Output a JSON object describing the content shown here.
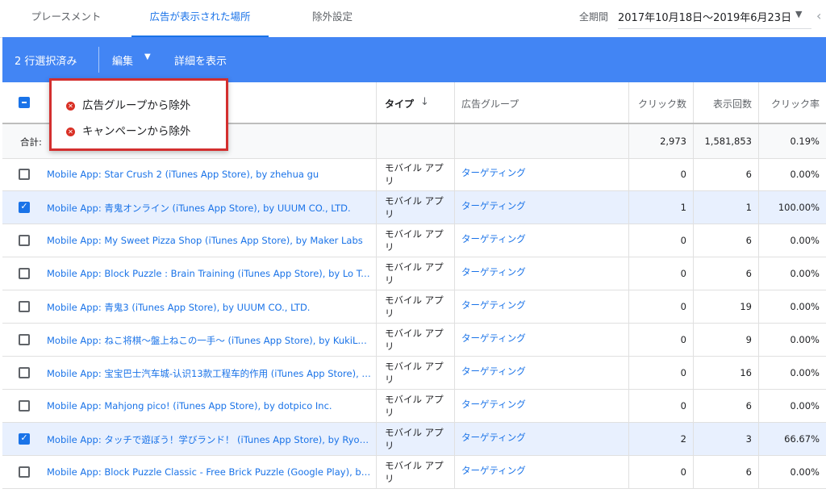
{
  "tabs": [
    "プレースメント",
    "広告が表示された場所",
    "除外設定"
  ],
  "active_tab": 1,
  "date": {
    "label": "全期間",
    "value": "2017年10月18日〜2019年6月23日"
  },
  "selection_bar": {
    "count_label": "2 行選択済み",
    "edit_label": "編集",
    "details_label": "詳細を表示"
  },
  "menu": {
    "items": [
      "広告グループから除外",
      "キャンペーンから除外"
    ]
  },
  "columns": {
    "type": "タイプ",
    "sort_icon": "arrow-down",
    "ad_group": "広告グループ",
    "clicks": "クリック数",
    "impressions": "表示回数",
    "ctr": "クリック率"
  },
  "total": {
    "label": "合計: ",
    "clicks": "2,973",
    "impressions": "1,581,853",
    "ctr": "0.19%"
  },
  "rows": [
    {
      "checked": false,
      "placement": "Mobile App: Star Crush 2 (iTunes App Store), by zhehua gu",
      "type": "モバイル アプリ",
      "ad_group": "ターゲティング",
      "clicks": "0",
      "impressions": "6",
      "ctr": "0.00%"
    },
    {
      "checked": true,
      "placement": "Mobile App: 青鬼オンライン (iTunes App Store), by UUUM CO., LTD.",
      "type": "モバイル アプリ",
      "ad_group": "ターゲティング",
      "clicks": "1",
      "impressions": "1",
      "ctr": "100.00%"
    },
    {
      "checked": false,
      "placement": "Mobile App: My Sweet Pizza Shop (iTunes App Store), by Maker Labs",
      "type": "モバイル アプリ",
      "ad_group": "ターゲティング",
      "clicks": "0",
      "impressions": "6",
      "ctr": "0.00%"
    },
    {
      "checked": false,
      "placement": "Mobile App: Block Puzzle : Brain Training (iTunes App Store), by Lo Trung ...",
      "type": "モバイル アプリ",
      "ad_group": "ターゲティング",
      "clicks": "0",
      "impressions": "6",
      "ctr": "0.00%"
    },
    {
      "checked": false,
      "placement": "Mobile App: 青鬼3 (iTunes App Store), by UUUM CO., LTD.",
      "type": "モバイル アプリ",
      "ad_group": "ターゲティング",
      "clicks": "0",
      "impressions": "19",
      "ctr": "0.00%"
    },
    {
      "checked": false,
      "placement": "Mobile App: ねこ将棋〜盤上ねこの一手〜 (iTunes App Store), by KukiLabo",
      "type": "モバイル アプリ",
      "ad_group": "ターゲティング",
      "clicks": "0",
      "impressions": "9",
      "ctr": "0.00%"
    },
    {
      "checked": false,
      "placement": "Mobile App: 宝宝巴士汽车城-认识13款工程车的作用 (iTunes App Store), b...",
      "type": "モバイル アプリ",
      "ad_group": "ターゲティング",
      "clicks": "0",
      "impressions": "16",
      "ctr": "0.00%"
    },
    {
      "checked": false,
      "placement": "Mobile App: Mahjong pico! (iTunes App Store), by dotpico Inc.",
      "type": "モバイル アプリ",
      "ad_group": "ターゲティング",
      "clicks": "0",
      "impressions": "6",
      "ctr": "0.00%"
    },
    {
      "checked": true,
      "placement": "Mobile App: タッチで遊ぼう！学びランド！ (iTunes App Store), by Ryo T...",
      "type": "モバイル アプリ",
      "ad_group": "ターゲティング",
      "clicks": "2",
      "impressions": "3",
      "ctr": "66.67%"
    },
    {
      "checked": false,
      "placement": "Mobile App: Block Puzzle Classic - Free Brick Puzzle (Google Play), by Infi...",
      "type": "モバイル アプリ",
      "ad_group": "ターゲティング",
      "clicks": "0",
      "impressions": "6",
      "ctr": "0.00%"
    }
  ]
}
